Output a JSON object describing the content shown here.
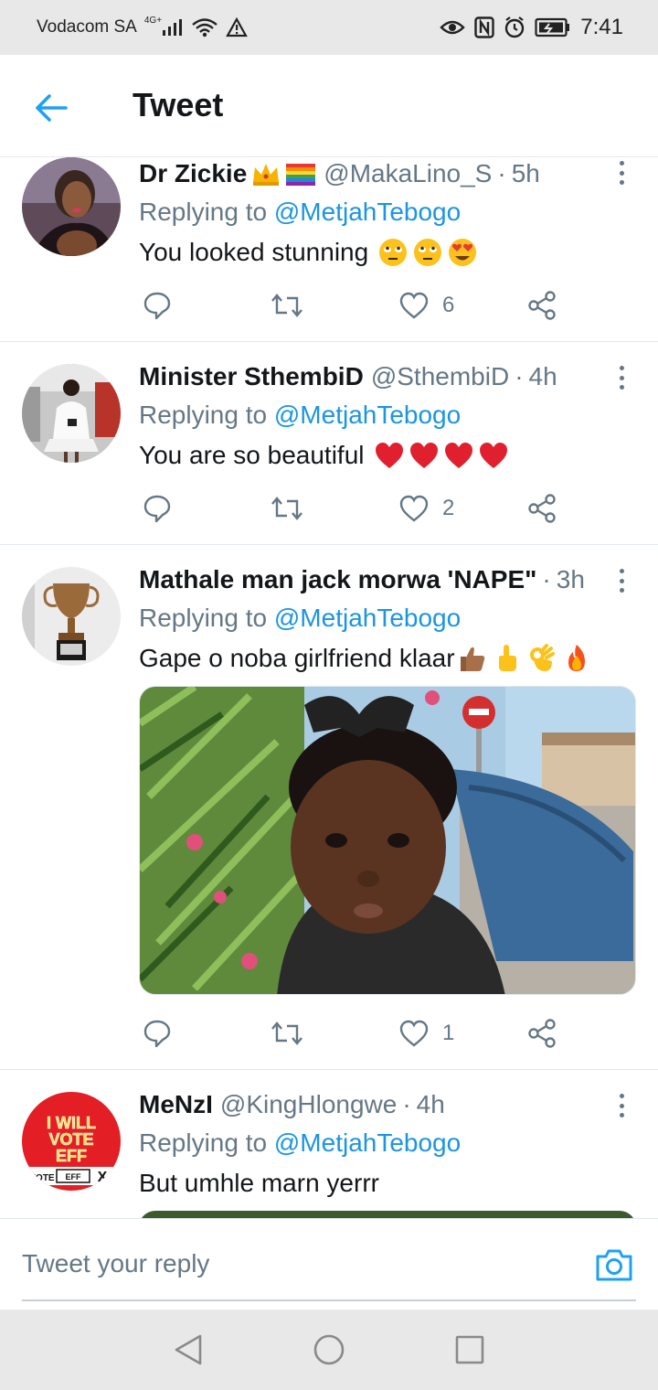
{
  "status_bar": {
    "carrier": "Vodacom SA",
    "network": "4G",
    "network_sup": "+",
    "time": "7:41"
  },
  "header": {
    "title": "Tweet"
  },
  "tweets": [
    {
      "name": "Dr Zickie",
      "name_emoji": [
        "crown",
        "rainbow-flag"
      ],
      "handle": "@MakaLino_S",
      "time": "5h",
      "replying_prefix": "Replying to",
      "replying_to": "@MetjahTebogo",
      "text": "You looked stunning",
      "text_emoji": [
        "face-with-rolling-eyes",
        "face-with-rolling-eyes",
        "smiling-face-with-heart-eyes"
      ],
      "likes": "6"
    },
    {
      "name": "Minister SthembiD",
      "handle": "@SthembiD",
      "time": "4h",
      "replying_prefix": "Replying to",
      "replying_to": "@MetjahTebogo",
      "text": "You are so beautiful",
      "text_emoji": [
        "red-heart",
        "red-heart",
        "red-heart",
        "red-heart"
      ],
      "likes": "2"
    },
    {
      "name": "Mathale man jack morwa 'NAPE\"",
      "handle": "",
      "time": "3h",
      "replying_prefix": "Replying to",
      "replying_to": "@MetjahTebogo",
      "text": "Gape o noba girlfriend klaar",
      "text_emoji": [
        "thumbs-up",
        "index-pointing-up",
        "ok-hand",
        "fire"
      ],
      "media": "photo-of-child-with-backpack",
      "likes": "1"
    },
    {
      "name": "MeNzI",
      "handle": "@KingHlongwe",
      "time": "4h",
      "replying_prefix": "Replying to",
      "replying_to": "@MetjahTebogo",
      "text": "But umhle marn yerrr",
      "avatar_text": [
        "I WILL",
        "VOTE",
        "EFF",
        "VOTE",
        "EFF",
        "X"
      ]
    }
  ],
  "reply_bar": {
    "placeholder": "Tweet your reply"
  },
  "colors": {
    "accent": "#1da1f2",
    "mention": "#1b95e0",
    "secondary_text": "#657786",
    "primary_text": "#14171a",
    "divider": "#e1e8ed"
  }
}
